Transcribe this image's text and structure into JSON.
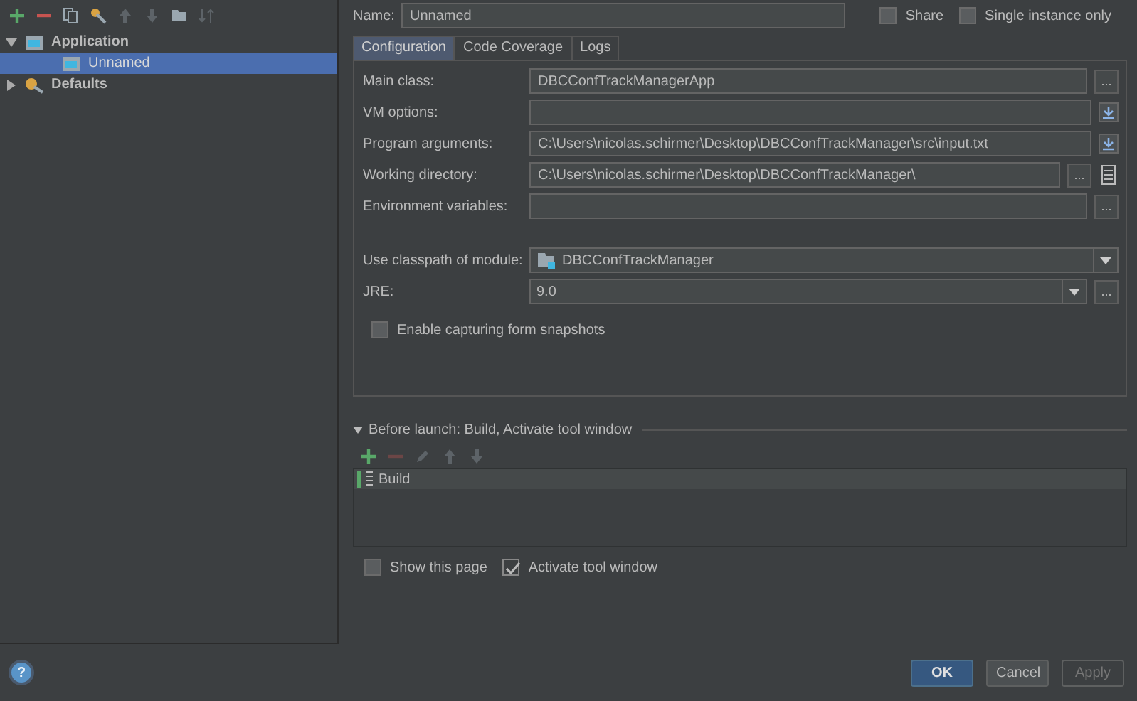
{
  "toolbar": [
    {
      "kind": "add",
      "disabled": false
    },
    {
      "kind": "remove",
      "disabled": false
    },
    {
      "kind": "copy",
      "disabled": false
    },
    {
      "kind": "settings",
      "disabled": false
    },
    {
      "kind": "up",
      "disabled": true
    },
    {
      "kind": "down",
      "disabled": true
    },
    {
      "kind": "folder",
      "disabled": false
    },
    {
      "kind": "sort",
      "disabled": true
    }
  ],
  "tree": [
    {
      "label": "Application",
      "kind": "app",
      "expanded": true,
      "selected": false,
      "children": [
        {
          "label": "Unnamed",
          "kind": "app",
          "selected": true
        }
      ]
    },
    {
      "label": "Defaults",
      "kind": "defaults",
      "expanded": false,
      "selected": false
    }
  ],
  "name": {
    "label": "Name:",
    "value": "Unnamed"
  },
  "options": [
    {
      "label": "Share",
      "checked": false
    },
    {
      "label": "Single instance only",
      "checked": false
    }
  ],
  "tabs": [
    {
      "label": "Configuration",
      "selected": true
    },
    {
      "label": "Code Coverage",
      "selected": false
    },
    {
      "label": "Logs",
      "selected": false
    }
  ],
  "fields": [
    {
      "label": "Main class:",
      "value": "DBCConfTrackManagerApp",
      "kind": "text",
      "extras": [
        {
          "kind": "browse",
          "text": "..."
        }
      ]
    },
    {
      "label": "VM options:",
      "kind": "text",
      "extras": [
        {
          "kind": "expand"
        }
      ]
    },
    {
      "label": "Program arguments:",
      "value": "C:\\Users\\nicolas.schirmer\\Desktop\\DBCConfTrackManager\\src\\input.txt",
      "kind": "text",
      "extras": [
        {
          "kind": "expand"
        }
      ]
    },
    {
      "label": "Working directory:",
      "value": "C:\\Users\\nicolas.schirmer\\Desktop\\DBCConfTrackManager\\",
      "kind": "text",
      "extras": [
        {
          "kind": "browse",
          "text": "..."
        },
        {
          "kind": "macro"
        }
      ]
    },
    {
      "label": "Environment variables:",
      "kind": "text",
      "extras": [
        {
          "kind": "browse",
          "text": "..."
        }
      ]
    },
    {
      "kind": "spacer"
    },
    {
      "label": "Use classpath of module:",
      "value": "DBCConfTrackManager",
      "kind": "module_combo"
    },
    {
      "label": "JRE:",
      "value": "9.0",
      "kind": "combo",
      "extras": [
        {
          "kind": "browse",
          "text": "..."
        }
      ]
    }
  ],
  "capture": {
    "label": "Enable capturing form snapshots",
    "checked": false
  },
  "before_launch": {
    "title": "Before launch: Build, Activate tool window",
    "expanded": true,
    "tools": [
      {
        "kind": "add",
        "disabled": false
      },
      {
        "kind": "remove",
        "disabled": true
      },
      {
        "kind": "edit",
        "disabled": true
      },
      {
        "kind": "up",
        "disabled": true
      },
      {
        "kind": "down",
        "disabled": true
      }
    ],
    "tasks": [
      {
        "label": "Build",
        "selected": true
      }
    ]
  },
  "footer_options": [
    {
      "label": "Show this page",
      "checked": false
    },
    {
      "label": "Activate tool window",
      "checked": true
    }
  ],
  "help": "?",
  "buttons": [
    {
      "label": "OK",
      "kind": "default",
      "disabled": false
    },
    {
      "label": "Cancel",
      "kind": "normal",
      "disabled": false
    },
    {
      "label": "Apply",
      "kind": "normal",
      "disabled": true
    }
  ]
}
